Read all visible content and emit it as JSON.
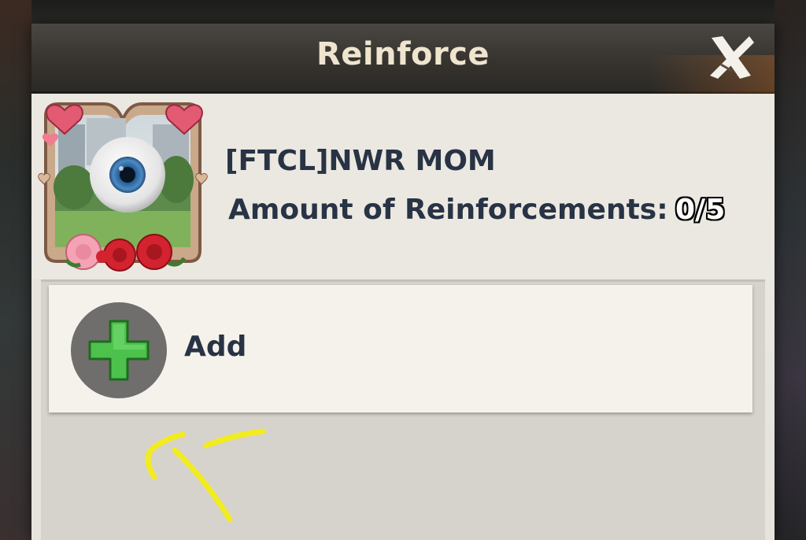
{
  "dialog": {
    "title": "Reinforce",
    "close_icon": "close-x-icon"
  },
  "player": {
    "name": "[FTCL]NWR MOM",
    "avatar_icon": "eyeball-portrait-heart-frame-icon"
  },
  "reinforcements": {
    "label": "Amount of Reinforcements:",
    "count": "0/5"
  },
  "slots": [
    {
      "label": "Add",
      "icon": "plus-icon"
    }
  ],
  "colors": {
    "title_text": "#efe5cf",
    "body_text": "#283345",
    "plus_green": "#4cc24c",
    "annotation_yellow": "#f2ec1f"
  }
}
